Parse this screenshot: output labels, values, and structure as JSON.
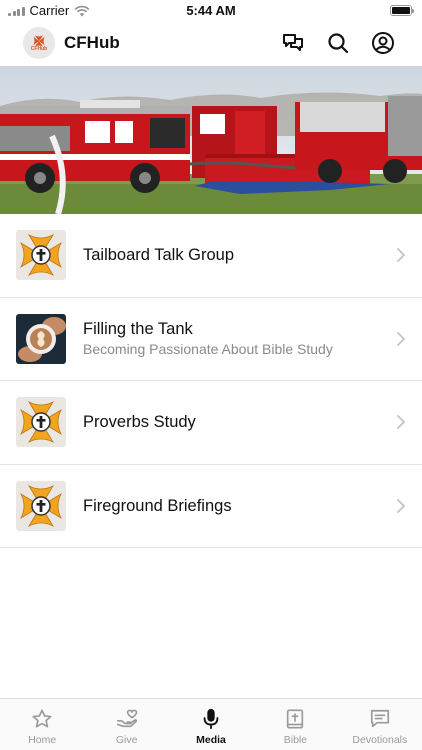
{
  "status_bar": {
    "carrier": "Carrier",
    "time": "5:44 AM"
  },
  "header": {
    "app_name": "CFHub",
    "logo_text": "CFHub"
  },
  "banner": {
    "icon": "fire-trucks-photo"
  },
  "media_list": [
    {
      "title": "Tailboard Talk Group",
      "subtitle": "",
      "thumb": "maltese-cross-icon"
    },
    {
      "title": "Filling the Tank",
      "subtitle": "Becoming Passionate About Bible Study",
      "thumb": "coffee-cup-photo"
    },
    {
      "title": "Proverbs Study",
      "subtitle": "",
      "thumb": "maltese-cross-icon"
    },
    {
      "title": "Fireground Briefings",
      "subtitle": "",
      "thumb": "maltese-cross-icon"
    }
  ],
  "tab_bar": {
    "active": "Media",
    "tabs": [
      {
        "label": "Home",
        "icon": "star-icon"
      },
      {
        "label": "Give",
        "icon": "hand-heart-icon"
      },
      {
        "label": "Media",
        "icon": "microphone-icon"
      },
      {
        "label": "Bible",
        "icon": "bible-icon"
      },
      {
        "label": "Devotionals",
        "icon": "message-icon"
      }
    ]
  },
  "colors": {
    "accent_orange": "#f2a41f",
    "brand_orange": "#d9531e",
    "inactive_gray": "#9a9a9a",
    "truck_red": "#c8161d"
  }
}
